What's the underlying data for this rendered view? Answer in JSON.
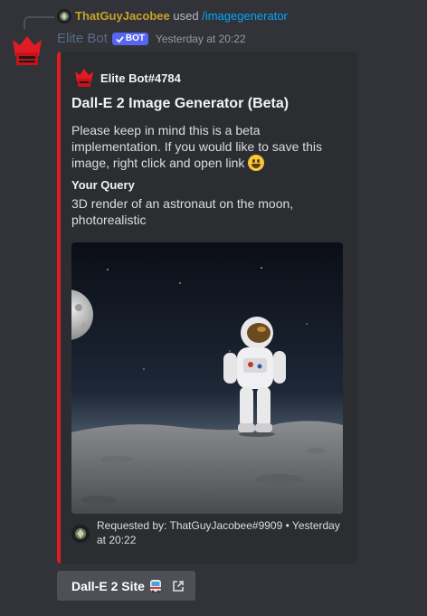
{
  "reply": {
    "user": "ThatGuyJacobee",
    "action": "used",
    "command": "/imagegenerator"
  },
  "message": {
    "author": "Elite Bot",
    "tag": "BOT",
    "timestamp": "Yesterday at 20:22"
  },
  "embed": {
    "accent_color": "#e01b24",
    "author_name": "Elite Bot#4784",
    "title": "Dall-E 2 Image Generator (Beta)",
    "description": "Please keep in mind this is a beta implementation. If you would like to save this image, right click and open link",
    "description_emoji": "grinning-face-emoji",
    "field_name": "Your Query",
    "field_value": "3D render of an astronaut on the moon, photorealistic",
    "image_icon": "astronaut-on-moon-image",
    "footer": "Requested by: ThatGuyJacobee#9909 • Yesterday at 20:22"
  },
  "button": {
    "label": "Dall-E 2 Site",
    "emoji": "bus-emoji",
    "icon": "external-link-icon"
  }
}
